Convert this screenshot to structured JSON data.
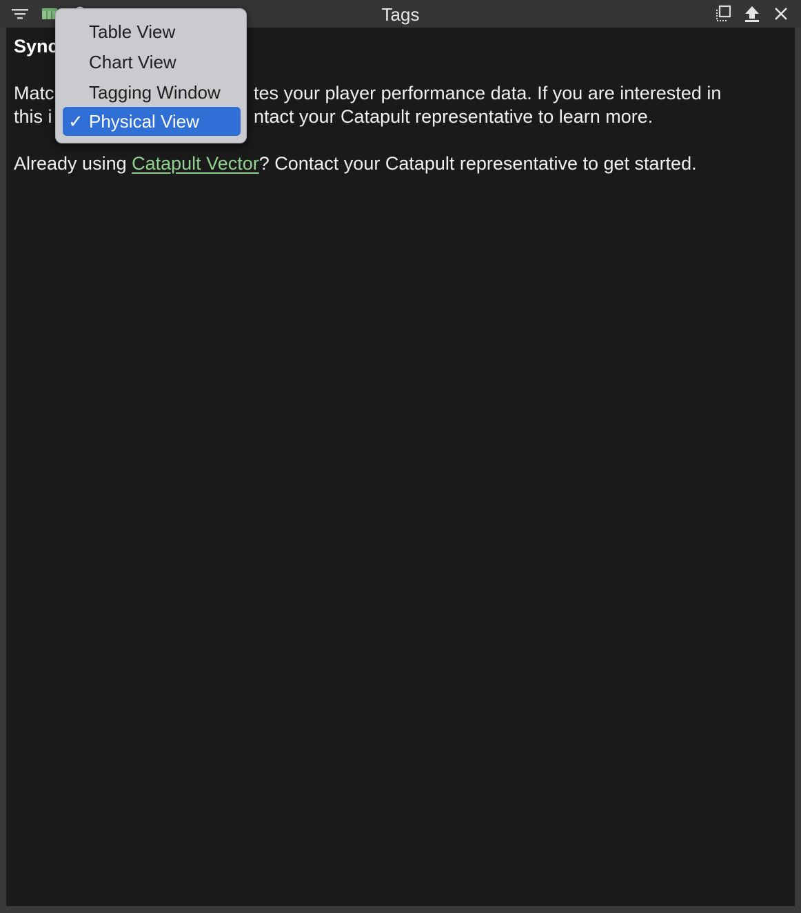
{
  "window": {
    "title": "Tags"
  },
  "toolbar": {
    "filter_icon": "filter-icon",
    "view_icon": "table-view-icon",
    "search_icon": "search-icon",
    "detach_icon": "detach-window-icon",
    "upload_icon": "upload-icon",
    "close_icon": "close-icon"
  },
  "content": {
    "heading_visible": "Sync",
    "para1_line1_left": "Matc",
    "para1_line1_right": "tes your player performance data. If you are interested in",
    "para1_line2_left": "this i",
    "para1_line2_right": "ntact your Catapult representative to learn more.",
    "para2_prefix": "Already using ",
    "para2_link": "Catapult Vector",
    "para2_suffix": "? Contact your Catapult representative to get started."
  },
  "view_menu": {
    "items": [
      {
        "label": "Table View",
        "checked": false
      },
      {
        "label": "Chart View",
        "checked": false
      },
      {
        "label": "Tagging Window",
        "checked": false
      },
      {
        "label": "Physical View",
        "checked": true
      }
    ],
    "check_glyph": "✓"
  },
  "colors": {
    "accent": "#2f6fd6",
    "link": "#8fd18f",
    "background": "#1a1a1a",
    "menu_bg": "#c9cbce"
  }
}
